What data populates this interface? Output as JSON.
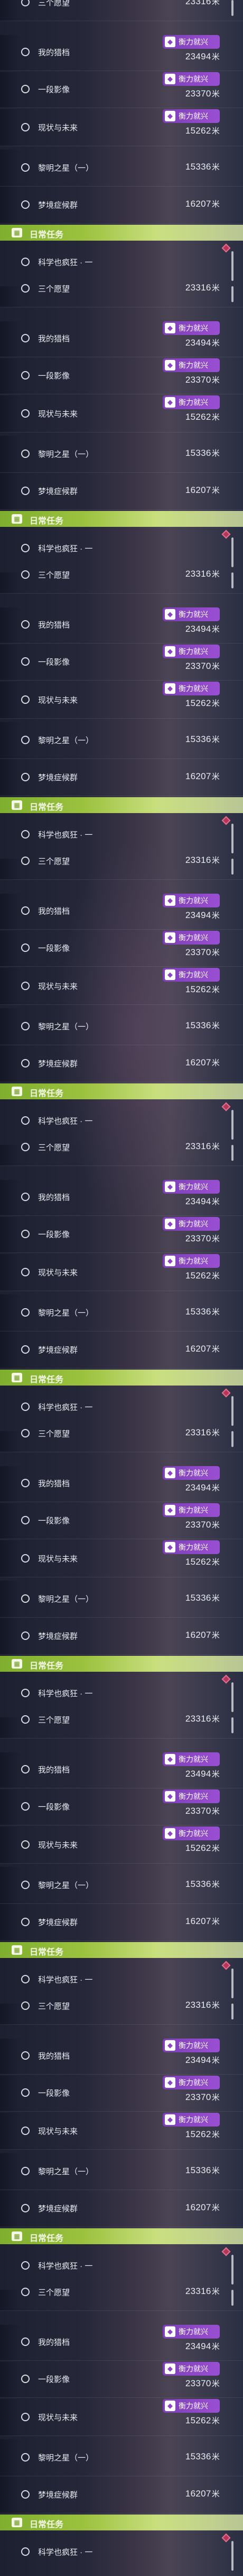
{
  "colors": {
    "badge": "#8a45c8",
    "daily_header": "#9cc23f",
    "marker": "#b8355a"
  },
  "icons": {
    "radio": "radio-circle-icon",
    "badge": "tag-icon",
    "daily": "calendar-icon",
    "marker": "diamond-marker-icon"
  },
  "panel": {
    "items": [
      {
        "title": "三个愿望",
        "points": "23316",
        "unit": "米",
        "badge": ""
      },
      {
        "title": "我的猎档",
        "points": "23494",
        "unit": "米",
        "badge": "衡力就兴"
      },
      {
        "title": "一段影像",
        "points": "23370",
        "unit": "米",
        "badge": "衡力就兴"
      },
      {
        "title": "现状与未来",
        "points": "15262",
        "unit": "米",
        "badge": "衡力就兴"
      },
      {
        "title": "黎明之星（一）",
        "points": "15336",
        "unit": "米",
        "badge": ""
      },
      {
        "title": "梦境症候群",
        "points": "16207",
        "unit": "米",
        "badge": ""
      }
    ],
    "daily_label": "日常任务",
    "daily_task_title": "科学也疯狂 · 一"
  }
}
